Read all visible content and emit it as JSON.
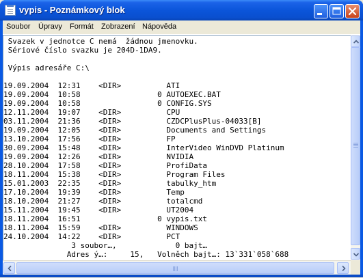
{
  "window": {
    "title": "vypis - Poznámkový blok",
    "controls": {
      "minimize_icon": "minimize-icon",
      "maximize_icon": "maximize-icon",
      "close_icon": "close-icon"
    }
  },
  "menubar": {
    "items": [
      "Soubor",
      "Úpravy",
      "Formát",
      "Zobrazení",
      "Nápověda"
    ]
  },
  "editor": {
    "lines": [
      " Svazek v jednotce C nemá  žádnou jmenovku.",
      " Sériové číslo svazku je 204D-1DA9.",
      "",
      " Výpis adresáře C:\\",
      "",
      "19.09.2004  12:31    <DIR>          ATI",
      "19.09.2004  10:58                 0 AUTOEXEC.BAT",
      "19.09.2004  10:58                 0 CONFIG.SYS",
      "12.11.2004  19:07    <DIR>          CPU",
      "03.11.2004  21:36    <DIR>          CZDCPlusPlus-04033[B]",
      "19.09.2004  12:05    <DIR>          Documents and Settings",
      "13.10.2004  17:56    <DIR>          FP",
      "30.09.2004  15:48    <DIR>          InterVideo WinDVD Platinum",
      "19.09.2004  12:26    <DIR>          NVIDIA",
      "28.10.2004  17:58    <DIR>          ProfiData",
      "18.11.2004  15:38    <DIR>          Program Files",
      "15.01.2003  22:35    <DIR>          tabulky_htm",
      "17.10.2004  19:39    <DIR>          Temp",
      "18.10.2004  21:27    <DIR>          totalcmd",
      "15.11.2004  19:45    <DIR>          UT2004",
      "18.11.2004  16:51                 0 vypis.txt",
      "18.11.2004  15:59    <DIR>          WINDOWS",
      "24.10.2004  14:22    <DIR>          PCT",
      "               3 soubor…,             0 bajt…",
      "              Adres ý…:     15,   Volněch bajt…: 13`331`058`688"
    ]
  }
}
